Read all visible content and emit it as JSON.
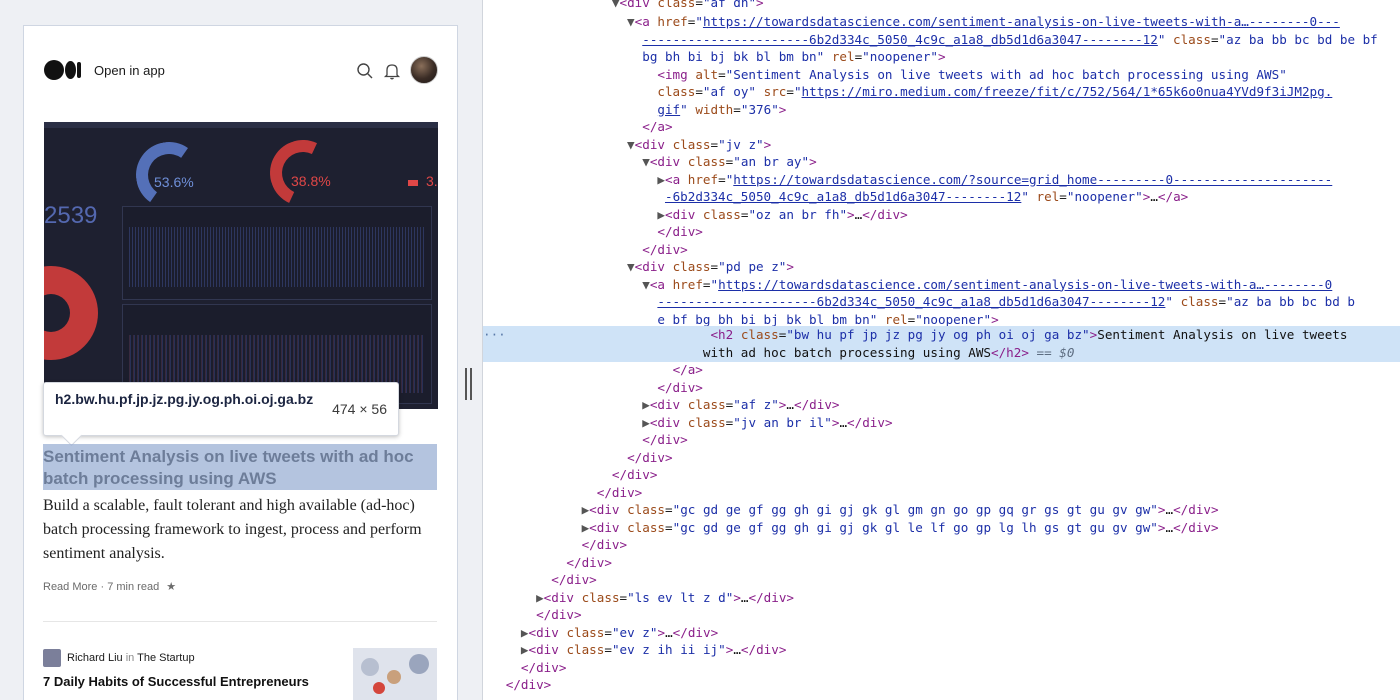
{
  "mobile": {
    "topbar": {
      "open_app": "Open in app"
    },
    "hero_dashboard": {
      "gauge_1": "53.6%",
      "gauge_2": "38.8%",
      "gauge_3": "3.",
      "big_number": "2539"
    },
    "tooltip": {
      "selector": "h2.bw.hu.pf.jp.jz.pg.jy.og.ph.oi.oj.ga.bz",
      "size": "474 × 56"
    },
    "article": {
      "title": "Sentiment Analysis on live tweets with ad hoc batch processing using AWS",
      "description": "Build a scalable, fault tolerant and high available (ad-hoc) batch processing framework to ingest, process and perform sentiment analysis.",
      "read_more": "Read More",
      "read_time": "7 min read",
      "separator": "·",
      "star": "★"
    },
    "next_article": {
      "author": "Richard Liu",
      "in_word": "in",
      "publication": "The Startup",
      "title": "7 Daily Habits of Successful Entrepreneurs"
    }
  },
  "devtools": {
    "selected_suffix": "== $0",
    "gutter_dots": "···",
    "lines": {
      "l0_class": "af dn",
      "l1_href": "https://towardsdatascience.com/sentiment-analysis-on-live-tweets-with-a…--------0---",
      "l2_href_cont": "----------------------6b2d334c_5050_4c9c_a1a8_db5d1d6a3047--------12",
      "l2_class": "az ba bb bc bd be bf",
      "l3": "bg bh bi bj bk bl bm bn",
      "rel": "noopener",
      "l4_alt": "Sentiment Analysis on live tweets with ad hoc batch processing using AWS",
      "l5_class": "af oy",
      "l5_src": "https://miro.medium.com/freeze/fit/c/752/564/1*65k6o0nua4YVd9f3iJM2pg.",
      "l6_src_cont": "gif",
      "l6_width": "376",
      "l8_class": "jv z",
      "l9_class": "an br ay",
      "l10_href": "https://towardsdatascience.com/?source=grid_home---------0---------------------",
      "l11_href_cont": "-6b2d334c_5050_4c9c_a1a8_db5d1d6a3047--------12",
      "l12_class": "oz an br fh",
      "l15_class": "pd pe z",
      "l16_href": "https://towardsdatascience.com/sentiment-analysis-on-live-tweets-with-a…--------0",
      "l17_href_cont": "---------------------6b2d334c_5050_4c9c_a1a8_db5d1d6a3047--------12",
      "l17_class": "az ba bb bc bd b",
      "l18": "e bf bg bh bi bj bk bl bm bn",
      "l19_class": "bw hu pf jp jz pg jy og ph oi oj ga bz",
      "l19_text": "Sentiment Analysis on live tweets",
      "l20_text": "with ad hoc batch processing using AWS",
      "l23_class": "af z",
      "l24_class": "jv an br il",
      "l29_class": "gc gd ge gf gg gh gi gj gk gl gm gn go gp gq gr gs gt gu gv gw",
      "l30_class": "gc gd ge gf gg gh gi gj gk gl le lf go gp lg lh gs gt gu gv gw",
      "l34_class": "ls ev lt z d",
      "l36_class": "ev z",
      "l37_class": "ev z ih ii ij"
    }
  }
}
